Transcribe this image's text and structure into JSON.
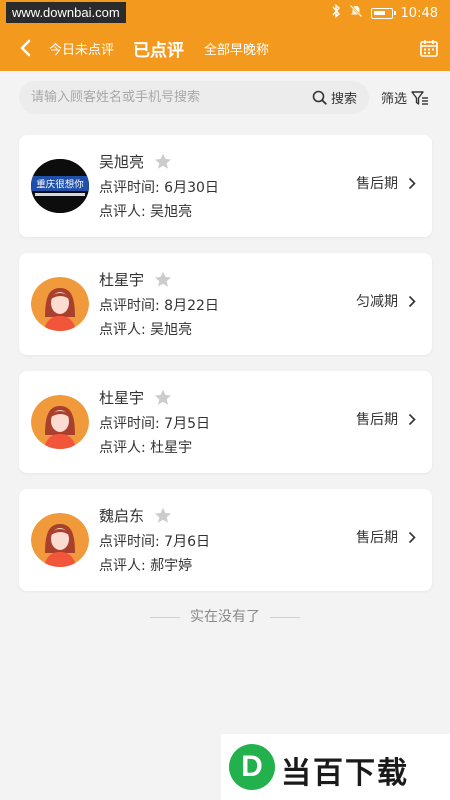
{
  "status_bar": {
    "watermark": "www.downbai.com",
    "time": "10:48"
  },
  "nav": {
    "tabs": [
      {
        "label": "今日未点评",
        "active": false
      },
      {
        "label": "已点评",
        "active": true
      },
      {
        "label": "全部早晚称",
        "active": false
      }
    ]
  },
  "search": {
    "placeholder": "请输入顾客姓名或手机号搜索",
    "value": "",
    "button_label": "搜索",
    "filter_label": "筛选"
  },
  "cards": [
    {
      "name": "吴旭亮",
      "time_label": "点评时间:",
      "time": "6月30日",
      "reviewer_label": "点评人:",
      "reviewer": "吴旭亮",
      "stage": "售后期",
      "avatar": "photo-avatar",
      "avatar_text": "重庆很想你"
    },
    {
      "name": "杜星宇",
      "time_label": "点评时间:",
      "time": "8月22日",
      "reviewer_label": "点评人:",
      "reviewer": "吴旭亮",
      "stage": "匀减期",
      "avatar": "default-female-avatar"
    },
    {
      "name": "杜星宇",
      "time_label": "点评时间:",
      "time": "7月5日",
      "reviewer_label": "点评人:",
      "reviewer": "杜星宇",
      "stage": "售后期",
      "avatar": "default-female-avatar"
    },
    {
      "name": "魏启东",
      "time_label": "点评时间:",
      "time": "7月6日",
      "reviewer_label": "点评人:",
      "reviewer": "郝宇婷",
      "stage": "售后期",
      "avatar": "default-female-avatar"
    }
  ],
  "end_text": "实在没有了",
  "watermark_logo": {
    "letter": "D",
    "text": "当百下载"
  },
  "colors": {
    "accent": "#f39a1e",
    "star": "#cccccc",
    "logo_green": "#22b14c"
  }
}
